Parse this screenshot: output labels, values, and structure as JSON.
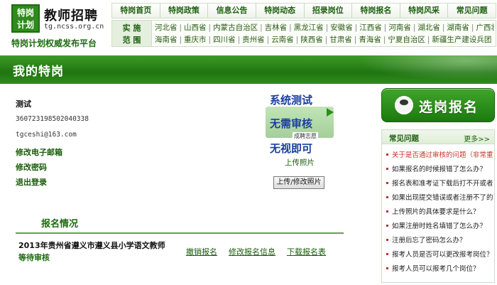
{
  "header": {
    "logo_line1": "特岗",
    "logo_line2": "计划",
    "title": "教师招聘",
    "url": "tg.ncss.org.cn",
    "slogan": "特岗计划权威发布平台"
  },
  "topnav": [
    "特岗首页",
    "特岗政策",
    "信息公告",
    "特岗动态",
    "招录岗位",
    "特岗报名",
    "特岗风采",
    "常见问题"
  ],
  "region": {
    "label_line1": "实 施",
    "label_line2": "范 围",
    "row1": [
      "河北省",
      "山西省",
      "内蒙古自治区",
      "吉林省",
      "黑龙江省",
      "安徽省",
      "江西省",
      "河南省",
      "湖北省",
      "湖南省",
      "广西壮族自治区"
    ],
    "row2": [
      "海南省",
      "重庆市",
      "四川省",
      "贵州省",
      "云南省",
      "陕西省",
      "甘肃省",
      "青海省",
      "宁夏自治区",
      "新疆生产建设兵团"
    ]
  },
  "banner": {
    "title": "我的特岗"
  },
  "user": {
    "name": "测试",
    "id_number": "360723198502040338",
    "email": "tgceshi@163.com",
    "links": [
      "修改电子邮箱",
      "修改密码",
      "退出登录"
    ]
  },
  "photo": {
    "line1": "系统测试",
    "line2": "无需审核",
    "line3": "无视即可",
    "small_text": "成聘志愿",
    "caption": "上传照片",
    "button": "上传/修改照片"
  },
  "registration": {
    "title": "报名情况",
    "job": "2013年贵州省遵义市遵义县小学语文教师",
    "status": "等待审核",
    "actions": [
      "撤销报名",
      "修改报名信息",
      "下载报名表"
    ]
  },
  "sidebar": {
    "apply_label": "选岗报名",
    "faq_title": "常见问题",
    "faq_more": "更多>>",
    "faq_items": [
      "关于是否通过审核的问题（非常重",
      "如果报名的时候报错了怎么办？",
      "报名表和准考证下载后打不开或者",
      "如果出现提交错误或者注册不了的",
      "上传照片的具体要求是什么？",
      "如果注册时姓名填错了怎么办？",
      "注册后忘了密码怎么办？",
      "报考人员是否可以更改报考岗位？",
      "报考人员可以报考几个岗位？"
    ]
  },
  "colors": {
    "brand_green": "#1f7510",
    "link_green": "#1a5a0a",
    "faq_highlight": "#c0392b"
  }
}
